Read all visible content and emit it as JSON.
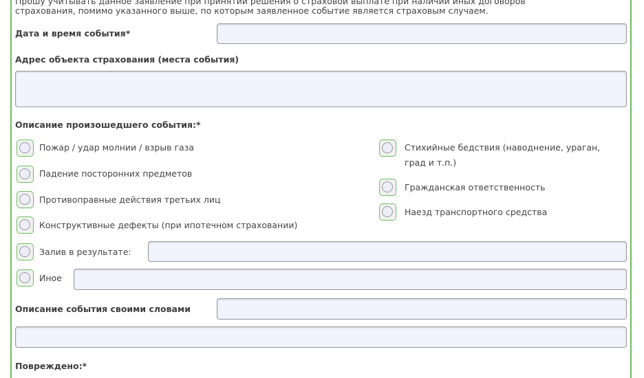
{
  "intro": {
    "line1": "Прошу учитывать данное заявление при принятии решения о страховой выплате при наличии иных договоров",
    "line2": "страхования, помимо указанного выше, по которым заявленное событие является страховым случаем."
  },
  "fields": {
    "datetime_label": "Дата и время события*",
    "address_label": "Адрес объекта страхования (места события)",
    "description_label": "Описание произошедшего события:*",
    "own_words_label": "Описание события своими словами",
    "damaged_label": "Повреждено:*"
  },
  "events_left": [
    {
      "label": "Пожар / удар молнии / взрыв газа"
    },
    {
      "label": "Падение посторонних предметов"
    },
    {
      "label": "Противоправные действия третьих лиц"
    },
    {
      "label": "Конструктивные дефекты (при ипотечном страховании)"
    },
    {
      "label": "Залив в результате:"
    },
    {
      "label": "Иное"
    }
  ],
  "events_right": [
    {
      "label1": "Стихийные бедствия (наводнение, ураган,",
      "label2": "град и т.п.)"
    },
    {
      "label": "Гражданская ответственность"
    },
    {
      "label": "Наезд транспортного средства"
    }
  ],
  "colors": {
    "accent": "#6cbf5e",
    "input_bg": "#f1f3fd"
  }
}
